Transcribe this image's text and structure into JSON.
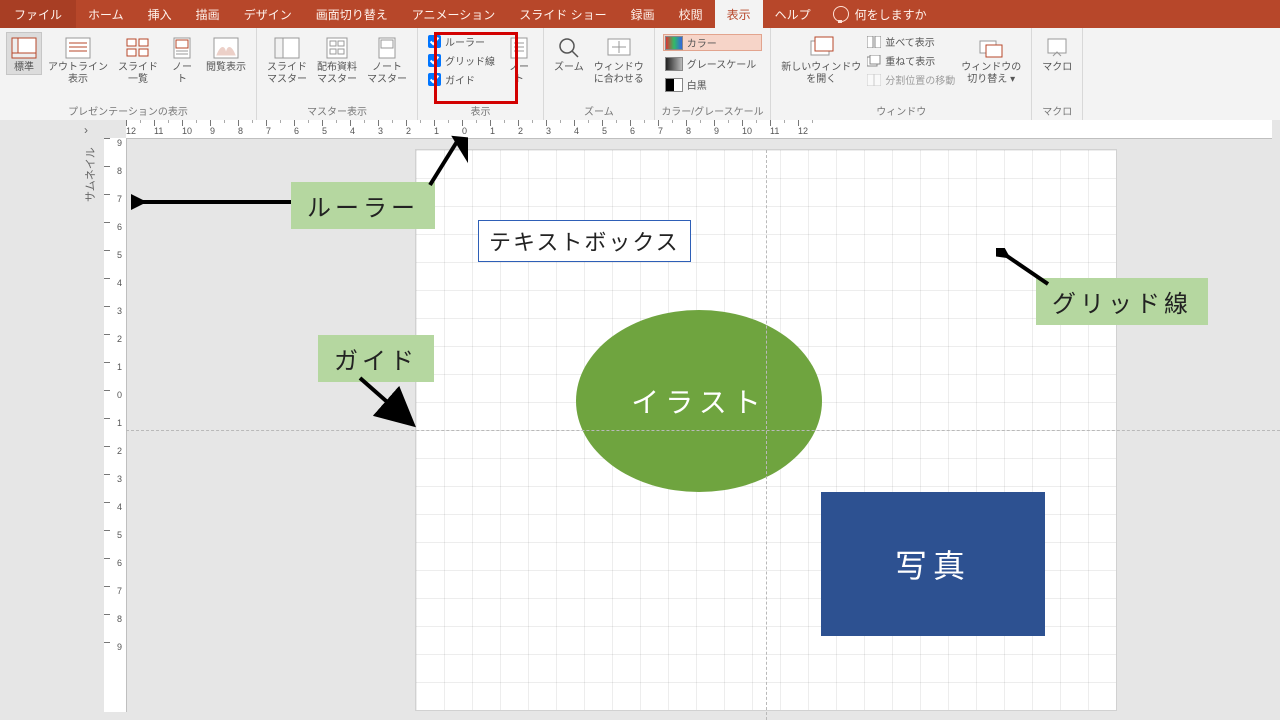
{
  "tabs": {
    "file": "ファイル",
    "items": [
      "ホーム",
      "挿入",
      "描画",
      "デザイン",
      "画面切り替え",
      "アニメーション",
      "スライド ショー",
      "録画",
      "校閲",
      "表示",
      "ヘルプ"
    ],
    "active_index": 9,
    "tell_me": "何をしますか"
  },
  "ribbon": {
    "presentation_views": {
      "label": "プレゼンテーションの表示",
      "normal": "標準",
      "outline": "アウトライン\n表示",
      "sorter": "スライド\n一覧",
      "notes": "ノー\nト",
      "reading": "閲覧表示"
    },
    "master_views": {
      "label": "マスター表示",
      "slide": "スライド\nマスター",
      "handout": "配布資料\nマスター",
      "notes": "ノート\nマスター"
    },
    "show": {
      "label": "表示",
      "ruler": "ルーラー",
      "grid": "グリッド線",
      "guides": "ガイド",
      "notes_btn": "ノー\nト"
    },
    "zoom": {
      "label": "ズーム",
      "zoom": "ズーム",
      "fit": "ウィンドウ\nに合わせる"
    },
    "color": {
      "label": "カラー/グレースケール",
      "color": "カラー",
      "gray": "グレースケール",
      "bw": "白黒"
    },
    "window": {
      "label": "ウィンドウ",
      "new": "新しいウィンドウ\nを開く",
      "arrange": "並べて表示",
      "cascade": "重ねて表示",
      "move_split": "分割位置の移動",
      "switch": "ウィンドウの\n切り替え ▾"
    },
    "macro": {
      "label": "マクロ",
      "btn": "マクロ"
    }
  },
  "ruler": {
    "h": [
      "12",
      "11",
      "10",
      "9",
      "8",
      "7",
      "6",
      "5",
      "4",
      "3",
      "2",
      "1",
      "0",
      "1",
      "2",
      "3",
      "4",
      "5",
      "6",
      "7",
      "8",
      "9",
      "10",
      "11",
      "12"
    ],
    "v": [
      "9",
      "8",
      "7",
      "6",
      "5",
      "4",
      "3",
      "2",
      "1",
      "0",
      "1",
      "2",
      "3",
      "4",
      "5",
      "6",
      "7",
      "8",
      "9"
    ]
  },
  "thumbnail_label": "サムネイル",
  "annotations": {
    "ruler": "ルーラー",
    "guide": "ガイド",
    "grid": "グリッド線"
  },
  "slide": {
    "textbox": "テキストボックス",
    "ellipse": "イラスト",
    "rect": "写真"
  }
}
